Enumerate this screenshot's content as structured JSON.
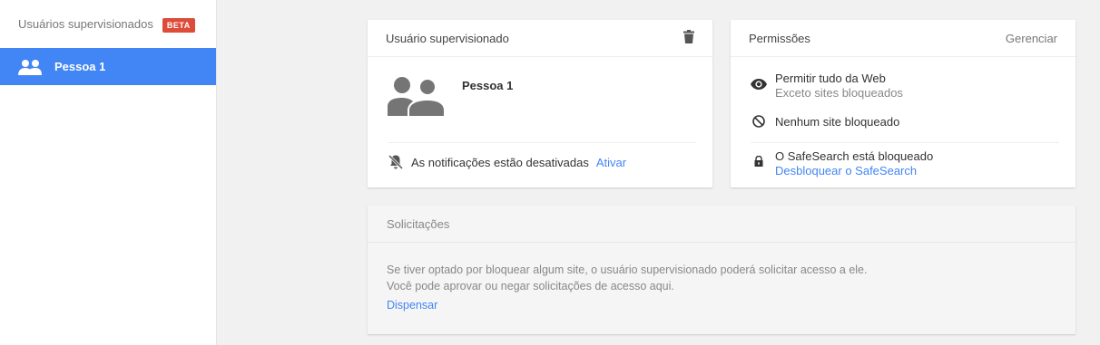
{
  "sidebar": {
    "title": "Usuários supervisionados",
    "beta_badge": "BETA",
    "items": [
      {
        "label": "Pessoa 1",
        "icon": "people-icon",
        "selected": true
      }
    ]
  },
  "user_card": {
    "title": "Usuário supervisionado",
    "delete_icon": "trash-icon",
    "name": "Pessoa 1",
    "notifications_text": "As notificações estão desativadas",
    "notifications_action": "Ativar"
  },
  "permissions_card": {
    "title": "Permissões",
    "manage_label": "Gerenciar",
    "allow_all": "Permitir tudo da Web",
    "allow_all_sub": "Exceto sites bloqueados",
    "no_blocked": "Nenhum site bloqueado",
    "safesearch": "O SafeSearch está bloqueado",
    "safesearch_action": "Desbloquear o SafeSearch"
  },
  "requests_card": {
    "title": "Solicitações",
    "line1": "Se tiver optado por bloquear algum site, o usuário supervisionado poderá solicitar acesso a ele.",
    "line2": "Você pode aprovar ou negar solicitações de acesso aqui.",
    "dismiss_label": "Dispensar"
  },
  "colors": {
    "accent": "#4285f4",
    "beta_bg": "#dd4b39",
    "icon_gray": "#757575"
  }
}
